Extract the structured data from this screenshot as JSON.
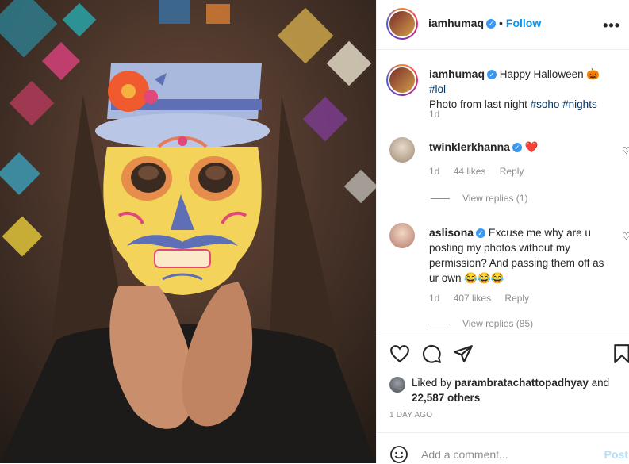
{
  "post": {
    "username": "iamhumaq",
    "follow_label": "Follow",
    "separator": "•",
    "more_label": "•••"
  },
  "caption": {
    "username": "iamhumaq",
    "text_1": "Happy Halloween",
    "emoji_1": "🎃",
    "hashtag_lol": "#lol",
    "text_2": "Photo from last night",
    "hashtag_soho": "#soho",
    "hashtag_nights": "#nights",
    "age": "1d"
  },
  "comments": [
    {
      "username": "twinklerkhanna",
      "text": "❤️",
      "age": "1d",
      "likes": "44 likes",
      "reply": "Reply",
      "view_replies": "View replies (1)"
    },
    {
      "username": "aslisona",
      "text": "Excuse me why are u posting my photos without my permission? And passing them off as ur own 😂😂😂",
      "age": "1d",
      "likes": "407 likes",
      "reply": "Reply",
      "view_replies": "View replies (85)"
    }
  ],
  "likes": {
    "prefix": "Liked by",
    "user": "parambratachattopadhyay",
    "and": "and",
    "others": "22,587 others"
  },
  "timestamp": "1 DAY AGO",
  "add_comment": {
    "placeholder": "Add a comment...",
    "post_label": "Post"
  },
  "icons": {
    "like": "heart-icon",
    "comment": "comment-icon",
    "share": "paper-plane-icon",
    "save": "bookmark-icon",
    "emoji": "smiley-icon"
  },
  "colors": {
    "link_blue": "#0095f6",
    "hashtag": "#00376b",
    "muted": "#8e8e8e",
    "verified": "#3897f0",
    "post_disabled": "#b2dffc"
  }
}
